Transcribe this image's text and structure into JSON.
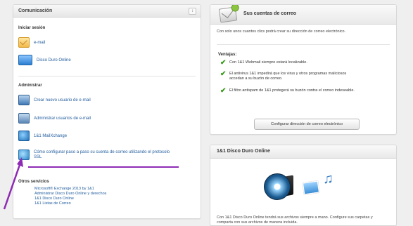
{
  "left_panel": {
    "title": "Comunicación",
    "header_button": "↕",
    "login_section": "Iniciar sesión",
    "login_items": [
      {
        "label": "e-mail",
        "icon": "mail-icon"
      },
      {
        "label": "Disco Duro Online",
        "icon": "disk-icon"
      }
    ],
    "admin_section": "Administrar",
    "admin_items": [
      {
        "label": "Crear nuevo usuario de e-mail",
        "icon": "user-icon"
      },
      {
        "label": "Administrar usuarios de e-mail",
        "icon": "users-icon"
      },
      {
        "label": "1&1 MailXchange",
        "icon": "exchange-icon"
      },
      {
        "label": "Cómo configurar paso a paso su cuenta de correo utilizando el protocolo SSL",
        "icon": "globe-icon"
      }
    ],
    "other_section": "Otros servicios",
    "other_links": [
      "Microsoft® Exchange 2013 by 1&1",
      "Administrar Disco Duro Online y derechos",
      "1&1 Disco Duro Online",
      "1&1 Listas de Correo"
    ]
  },
  "mail_panel": {
    "title": "Sus cuentas de correo",
    "intro": "Con solo unos cuantos clics podrá crear su dirección de correo electrónico.",
    "advantages_title": "Ventajas:",
    "advantages": [
      "Con 1&1 Webmail siempre estará localizable.",
      "El antivirus 1&1 impedirá que los virus y otros programas maliciosos accedan a su buzón de correo.",
      "El filtro antispam de 1&1 protegerá su buzón contra el correo indeseable."
    ],
    "config_button": "Configurar dirección de correo electrónico"
  },
  "disk_panel": {
    "title": "1&1 Disco Duro Online",
    "text": "Con 1&1 Disco Duro Online tendrá sus archivos siempre a mano. Configure sus carpetas y comparta con sus archivos de manera incluida."
  },
  "colors": {
    "annotation": "#8e2bb5",
    "link": "#1f5b9c",
    "check": "#3a9b1c"
  }
}
